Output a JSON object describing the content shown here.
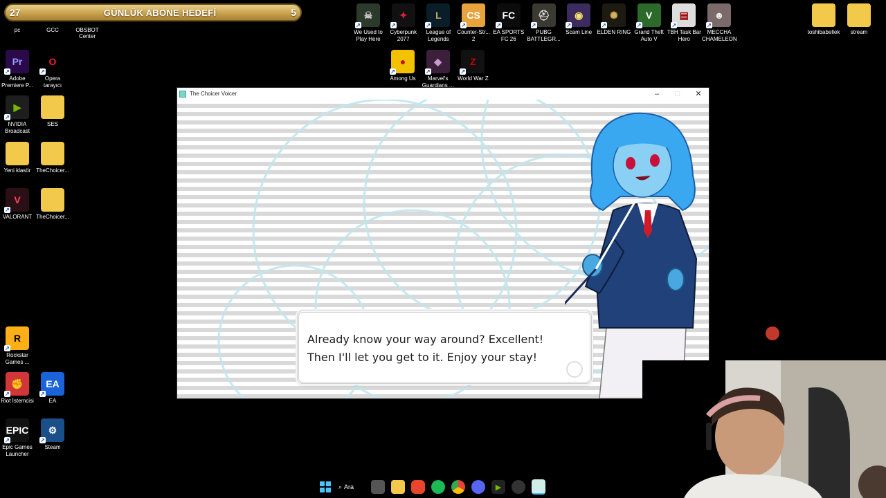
{
  "goal_bar": {
    "current": "27",
    "title": "GÜNLÜK ABONE HEDEFİ",
    "target": "5"
  },
  "top_labels": {
    "pc": "pc",
    "gcc": "GCC",
    "obsbot": "OBSBOT Center"
  },
  "desktop_left": [
    {
      "label": "Adobe Premiere P...",
      "icon": "premiere-icon",
      "color": "#2a0a4a",
      "glyph": "Pr",
      "glyph_color": "#9999ff"
    },
    {
      "label": "Opera tarayıcı",
      "icon": "opera-icon",
      "color": "#000000",
      "glyph": "O",
      "glyph_color": "#ff1b2d"
    },
    {
      "label": "NVIDIA Broadcast",
      "icon": "nvidia-icon",
      "color": "#1e1e1e",
      "glyph": "▶",
      "glyph_color": "#76b900"
    },
    {
      "label": "SES",
      "icon": "folder-icon",
      "color": "#f3c94b",
      "glyph": "",
      "glyph_color": "#fff"
    },
    {
      "label": "Yeni klasör",
      "icon": "folder-icon",
      "color": "#f3c94b",
      "glyph": "",
      "glyph_color": "#fff"
    },
    {
      "label": "TheChoicer...",
      "icon": "folder-icon",
      "color": "#f3c94b",
      "glyph": "",
      "glyph_color": "#fff"
    },
    {
      "label": "VALORANT",
      "icon": "valorant-icon",
      "color": "#2a0f14",
      "glyph": "V",
      "glyph_color": "#ff4655"
    },
    {
      "label": "TheChoicer...",
      "icon": "folder-icon",
      "color": "#f3c94b",
      "glyph": "",
      "glyph_color": "#fff"
    },
    {
      "label": "Rockstar Games ...",
      "icon": "rockstar-icon",
      "color": "#fcaf17",
      "glyph": "R",
      "glyph_color": "#000"
    },
    {
      "label": "Riot İstemcisi",
      "icon": "riot-icon",
      "color": "#d13639",
      "glyph": "✊",
      "glyph_color": "#fff"
    },
    {
      "label": "EA",
      "icon": "ea-icon",
      "color": "#1a63d8",
      "glyph": "EA",
      "glyph_color": "#fff"
    },
    {
      "label": "Epic Games Launcher",
      "icon": "epic-icon",
      "color": "#111111",
      "glyph": "EPIC",
      "glyph_color": "#fff"
    },
    {
      "label": "Steam",
      "icon": "steam-icon",
      "color": "#1b4f8a",
      "glyph": "⚙",
      "glyph_color": "#fff"
    }
  ],
  "desktop_top": [
    {
      "label": "We Used to Play Here",
      "icon": "game-icon",
      "color": "#2c3a2c",
      "glyph": "☠",
      "glyph_color": "#ccc"
    },
    {
      "label": "Cyberpunk 2077",
      "icon": "cyberpunk-icon",
      "color": "#111",
      "glyph": "✦",
      "glyph_color": "#e0203a"
    },
    {
      "label": "League of Legends",
      "icon": "lol-icon",
      "color": "#0a1e2a",
      "glyph": "L",
      "glyph_color": "#c8aa6e"
    },
    {
      "label": "Counter-Str... 2",
      "icon": "cs2-icon",
      "color": "#e8a33d",
      "glyph": "CS",
      "glyph_color": "#fff"
    },
    {
      "label": "EA SPORTS FC 26",
      "icon": "fc26-icon",
      "color": "#0c0c0c",
      "glyph": "FC",
      "glyph_color": "#fff"
    },
    {
      "label": "PUBG BATTLEGR...",
      "icon": "pubg-icon",
      "color": "#3a3a32",
      "glyph": "⛑",
      "glyph_color": "#ddd"
    },
    {
      "label": "Scam Line",
      "icon": "game-icon",
      "color": "#3b2b5e",
      "glyph": "◉",
      "glyph_color": "#f6e36a"
    },
    {
      "label": "ELDEN RING",
      "icon": "eldenring-icon",
      "color": "#1d1a12",
      "glyph": "✺",
      "glyph_color": "#d4b15c"
    },
    {
      "label": "Grand Theft Auto V",
      "icon": "gta-icon",
      "color": "#2c6a2c",
      "glyph": "V",
      "glyph_color": "#fff"
    },
    {
      "label": "TBH Task Bar Hero",
      "icon": "game-icon",
      "color": "#dddddd",
      "glyph": "▤",
      "glyph_color": "#900"
    },
    {
      "label": "MECCHA CHAMELEON",
      "icon": "game-icon",
      "color": "#7a6a6a",
      "glyph": "☻",
      "glyph_color": "#eee"
    }
  ],
  "desktop_top2": [
    {
      "label": "Among Us",
      "icon": "amongus-icon",
      "color": "#f2c200",
      "glyph": "●",
      "glyph_color": "#c51111"
    },
    {
      "label": "Marvel's Guardians ...",
      "icon": "gotg-icon",
      "color": "#3b1f3b",
      "glyph": "◆",
      "glyph_color": "#c9c"
    },
    {
      "label": "World War Z",
      "icon": "wwz-icon",
      "color": "#111",
      "glyph": "Z",
      "glyph_color": "#c00"
    }
  ],
  "desktop_right": [
    {
      "label": "toshibabellek",
      "icon": "folder-icon",
      "color": "#f3c94b",
      "glyph": "",
      "glyph_color": "#fff"
    },
    {
      "label": "stream",
      "icon": "folder-icon",
      "color": "#f3c94b",
      "glyph": "",
      "glyph_color": "#fff"
    }
  ],
  "window": {
    "title": "The Choicer Voicer",
    "dialog_line1": "Already know your way around? Excellent!",
    "dialog_line2": "Then I'll let you get to it. Enjoy your stay!"
  },
  "taskbar": {
    "search_label": "Ara",
    "items": [
      "start-icon",
      "search",
      "task-view-icon",
      "file-explorer-icon",
      "brave-icon",
      "spotify-icon",
      "chrome-icon",
      "discord-icon",
      "nvidia-icon",
      "steam-icon",
      "choicer-app-icon"
    ]
  }
}
